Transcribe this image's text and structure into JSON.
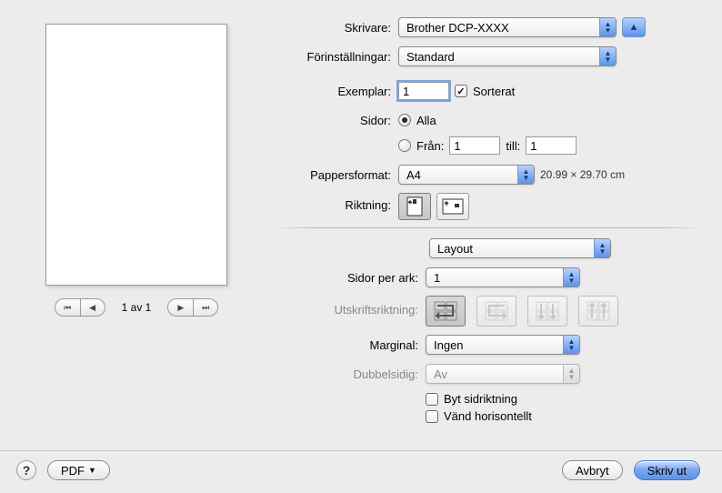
{
  "preview": {
    "page_counter": "1 av 1"
  },
  "labels": {
    "printer": "Skrivare:",
    "presets": "Förinställningar:",
    "copies": "Exemplar:",
    "collated": "Sorterat",
    "pages": "Sidor:",
    "all": "Alla",
    "from": "Från:",
    "to": "till:",
    "paper_size": "Pappersformat:",
    "orientation": "Riktning:",
    "section": "Layout",
    "pages_per_sheet": "Sidor per ark:",
    "layout_direction": "Utskriftsriktning:",
    "border": "Marginal:",
    "two_sided": "Dubbelsidig:",
    "reverse_orientation": "Byt sidriktning",
    "flip_horizontal": "Vänd horisontellt"
  },
  "values": {
    "printer": "Brother DCP-XXXX",
    "preset": "Standard",
    "copies": "1",
    "collated_checked": true,
    "pages_all_selected": true,
    "from": "1",
    "to": "1",
    "paper_size": "A4",
    "paper_dim": "20.99  ×  29.70 cm",
    "pages_per_sheet": "1",
    "border": "Ingen",
    "two_sided": "Av",
    "reverse_orientation_checked": false,
    "flip_horizontal_checked": false
  },
  "buttons": {
    "pdf": "PDF",
    "cancel": "Avbryt",
    "print": "Skriv ut"
  },
  "icons": {
    "collapse_arrow": "▲",
    "help": "?",
    "pdf_menu_arrow": "▼",
    "dropdown_up": "▲",
    "dropdown_down": "▼",
    "nav_first": "⏮",
    "nav_prev": "◀",
    "nav_next": "▶",
    "nav_last": "⏭",
    "check": "✓"
  }
}
